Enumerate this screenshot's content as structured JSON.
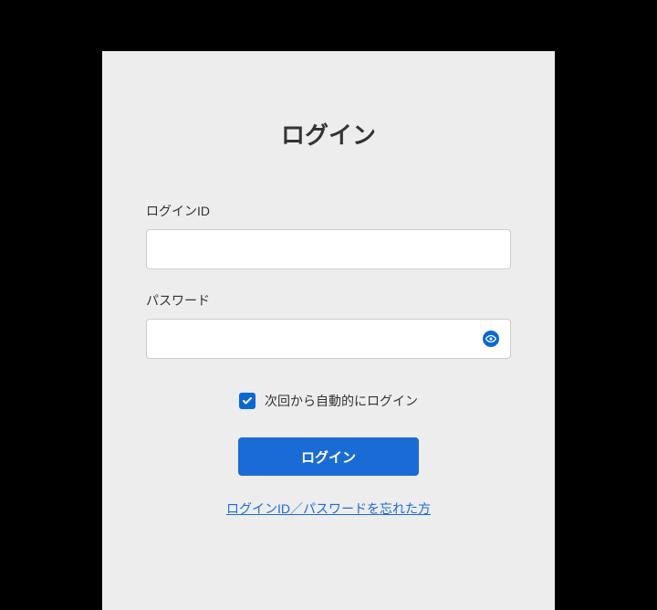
{
  "page": {
    "title": "ログイン"
  },
  "form": {
    "loginId": {
      "label": "ログインID",
      "value": ""
    },
    "password": {
      "label": "パスワード",
      "value": ""
    },
    "autoLogin": {
      "label": "次回から自動的にログイン",
      "checked": true
    },
    "submitLabel": "ログイン",
    "forgotLink": "ログインID／パスワードを忘れた方"
  }
}
